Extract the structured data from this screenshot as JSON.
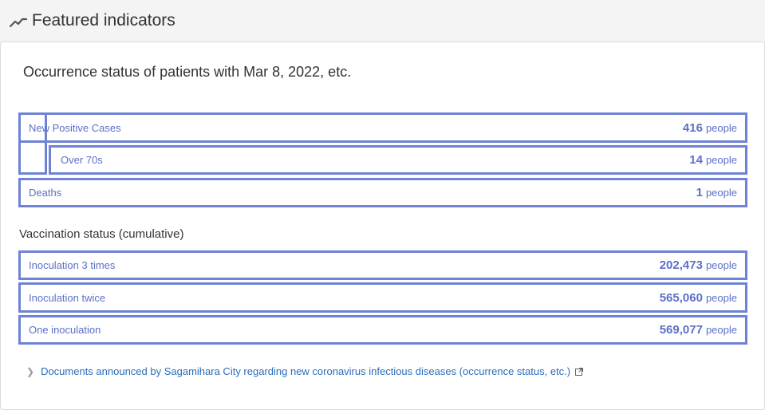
{
  "header": {
    "title": "Featured indicators",
    "icon": "trend-line-icon"
  },
  "occurrence": {
    "subtitle": "Occurrence status of patients with Mar 8, 2022, etc.",
    "new_positive": {
      "label": "New Positive Cases",
      "value": "416",
      "unit": "people"
    },
    "over_70s": {
      "label": "Over 70s",
      "value": "14",
      "unit": "people"
    },
    "deaths": {
      "label": "Deaths",
      "value": "1",
      "unit": "people"
    }
  },
  "vaccination": {
    "title": "Vaccination status (cumulative)",
    "three_times": {
      "label": "Inoculation 3 times",
      "value": "202,473",
      "unit": "people"
    },
    "twice": {
      "label": "Inoculation twice",
      "value": "565,060",
      "unit": "people"
    },
    "once": {
      "label": "One inoculation",
      "value": "569,077",
      "unit": "people"
    }
  },
  "footer_link": {
    "text": "Documents announced by Sagamihara City regarding new coronavirus infectious diseases (occurrence status, etc.)",
    "icon": "external-link-icon"
  },
  "colors": {
    "accent": "#6f82d6",
    "text": "#5b6fc9",
    "link": "#2a6ebb"
  }
}
